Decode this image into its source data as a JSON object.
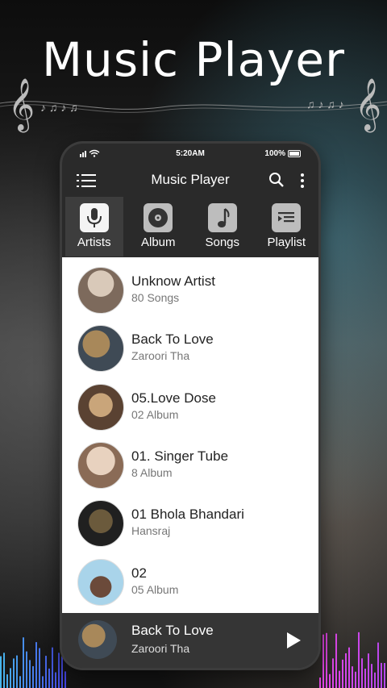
{
  "promo": {
    "title": "Music Player"
  },
  "status_bar": {
    "time": "5:20AM",
    "battery": "100%"
  },
  "app_bar": {
    "title": "Music Player"
  },
  "tabs": [
    {
      "label": "Artists",
      "icon": "microphone-icon",
      "active": true
    },
    {
      "label": "Album",
      "icon": "disc-icon",
      "active": false
    },
    {
      "label": "Songs",
      "icon": "music-note-icon",
      "active": false
    },
    {
      "label": "Playlist",
      "icon": "playlist-icon",
      "active": false
    }
  ],
  "artists": [
    {
      "name": "Unknow Artist",
      "sub": "80 Songs",
      "avatar_colors": [
        "#d9c9b9",
        "#7d6a5c"
      ]
    },
    {
      "name": "Back To Love",
      "sub": "Zaroori Tha",
      "avatar_colors": [
        "#a8885a",
        "#3f4a55"
      ]
    },
    {
      "name": "05.Love Dose",
      "sub": "02 Album",
      "avatar_colors": [
        "#c9a57a",
        "#5a4232"
      ]
    },
    {
      "name": "01. Singer Tube",
      "sub": "8 Album",
      "avatar_colors": [
        "#e8d2bf",
        "#8a6b56"
      ]
    },
    {
      "name": "01 Bhola Bhandari",
      "sub": "Hansraj",
      "avatar_colors": [
        "#6b5a3c",
        "#202020"
      ]
    },
    {
      "name": "02",
      "sub": "05 Album",
      "avatar_colors": [
        "#a9d4ea",
        "#6b4a3a"
      ]
    }
  ],
  "now_playing": {
    "title": "Back To Love",
    "subtitle": "Zaroori Tha"
  }
}
